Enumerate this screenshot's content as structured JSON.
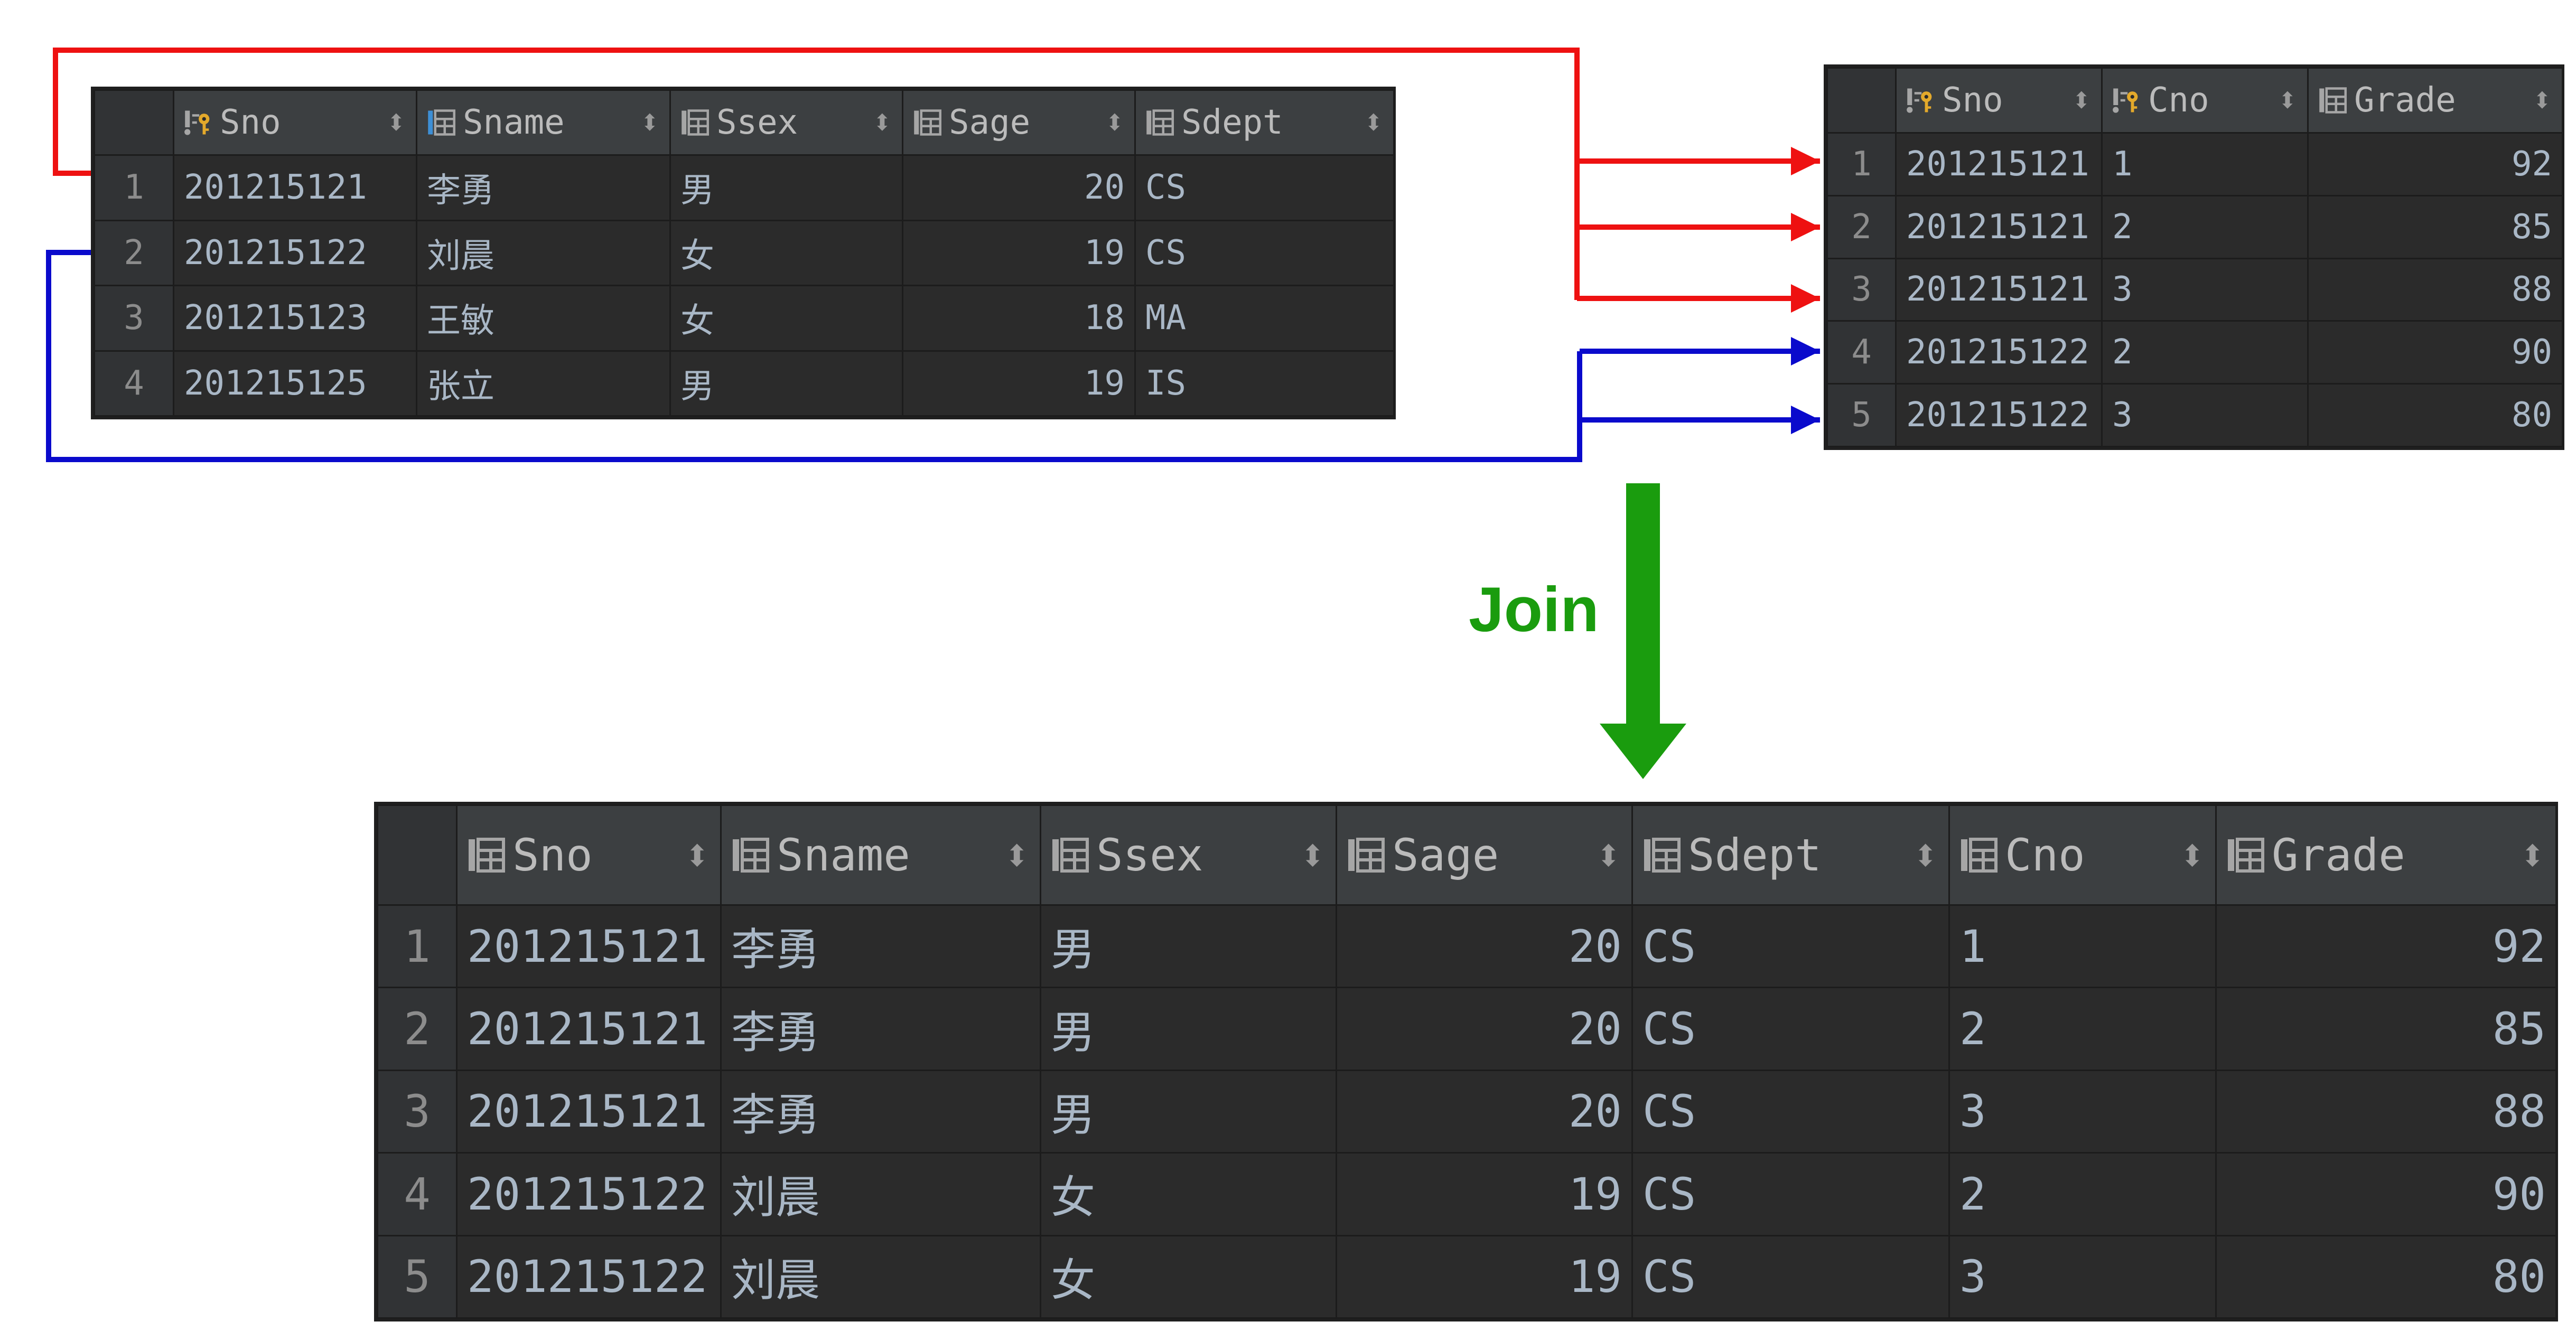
{
  "colors": {
    "red_connector": "#ee1111",
    "blue_connector": "#0a0acc",
    "join_arrow": "#1a9c0e",
    "grid_bg": "#2b2b2b",
    "header_bg": "#3c3f41"
  },
  "join_label": "Join",
  "student_table": {
    "columns": [
      {
        "name": "Sno",
        "icon": "primary-key-icon"
      },
      {
        "name": "Sname",
        "icon": "column-selected-icon"
      },
      {
        "name": "Ssex",
        "icon": "column-icon"
      },
      {
        "name": "Sage",
        "icon": "column-icon"
      },
      {
        "name": "Sdept",
        "icon": "column-icon"
      }
    ],
    "rows": [
      {
        "n": "1",
        "Sno": "201215121",
        "Sname": "李勇",
        "Ssex": "男",
        "Sage": "20",
        "Sdept": "CS"
      },
      {
        "n": "2",
        "Sno": "201215122",
        "Sname": "刘晨",
        "Ssex": "女",
        "Sage": "19",
        "Sdept": "CS"
      },
      {
        "n": "3",
        "Sno": "201215123",
        "Sname": "王敏",
        "Ssex": "女",
        "Sage": "18",
        "Sdept": "MA"
      },
      {
        "n": "4",
        "Sno": "201215125",
        "Sname": "张立",
        "Ssex": "男",
        "Sage": "19",
        "Sdept": "IS"
      }
    ]
  },
  "sc_table": {
    "columns": [
      {
        "name": "Sno",
        "icon": "primary-key-icon"
      },
      {
        "name": "Cno",
        "icon": "primary-key-icon"
      },
      {
        "name": "Grade",
        "icon": "column-icon"
      }
    ],
    "rows": [
      {
        "n": "1",
        "Sno": "201215121",
        "Cno": "1",
        "Grade": "92"
      },
      {
        "n": "2",
        "Sno": "201215121",
        "Cno": "2",
        "Grade": "85"
      },
      {
        "n": "3",
        "Sno": "201215121",
        "Cno": "3",
        "Grade": "88"
      },
      {
        "n": "4",
        "Sno": "201215122",
        "Cno": "2",
        "Grade": "90"
      },
      {
        "n": "5",
        "Sno": "201215122",
        "Cno": "3",
        "Grade": "80"
      }
    ]
  },
  "join_table": {
    "columns": [
      {
        "name": "Sno",
        "icon": "column-icon"
      },
      {
        "name": "Sname",
        "icon": "column-icon"
      },
      {
        "name": "Ssex",
        "icon": "column-icon"
      },
      {
        "name": "Sage",
        "icon": "column-icon"
      },
      {
        "name": "Sdept",
        "icon": "column-icon"
      },
      {
        "name": "Cno",
        "icon": "column-icon"
      },
      {
        "name": "Grade",
        "icon": "column-icon"
      }
    ],
    "rows": [
      {
        "n": "1",
        "Sno": "201215121",
        "Sname": "李勇",
        "Ssex": "男",
        "Sage": "20",
        "Sdept": "CS",
        "Cno": "1",
        "Grade": "92"
      },
      {
        "n": "2",
        "Sno": "201215121",
        "Sname": "李勇",
        "Ssex": "男",
        "Sage": "20",
        "Sdept": "CS",
        "Cno": "2",
        "Grade": "85"
      },
      {
        "n": "3",
        "Sno": "201215121",
        "Sname": "李勇",
        "Ssex": "男",
        "Sage": "20",
        "Sdept": "CS",
        "Cno": "3",
        "Grade": "88"
      },
      {
        "n": "4",
        "Sno": "201215122",
        "Sname": "刘晨",
        "Ssex": "女",
        "Sage": "19",
        "Sdept": "CS",
        "Cno": "2",
        "Grade": "90"
      },
      {
        "n": "5",
        "Sno": "201215122",
        "Sname": "刘晨",
        "Ssex": "女",
        "Sage": "19",
        "Sdept": "CS",
        "Cno": "3",
        "Grade": "80"
      }
    ]
  }
}
